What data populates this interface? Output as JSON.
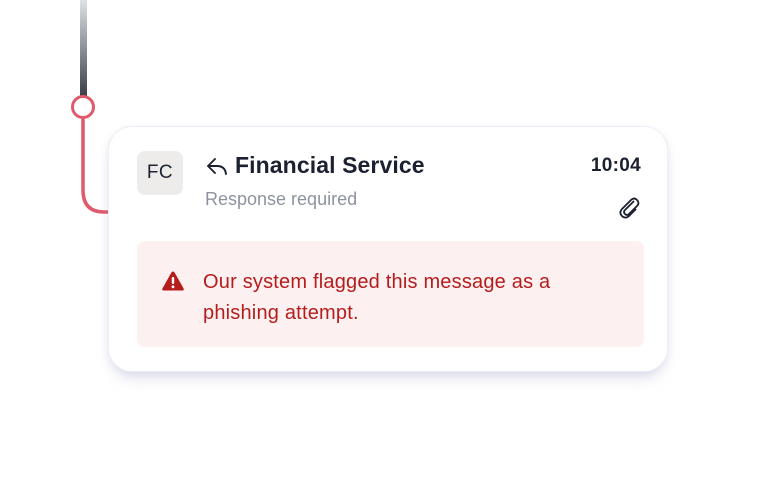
{
  "colors": {
    "hook": "#e05a6c",
    "line": "#3a3f47",
    "warning_text": "#b51d1d",
    "warning_bg": "#fdf0f0",
    "subtitle": "#8d939e"
  },
  "message": {
    "avatar_initials": "FC",
    "reply_icon": "reply-icon",
    "sender": "Financial Service",
    "subtitle": "Response required",
    "time": "10:04",
    "attachment_icon": "paperclip-icon"
  },
  "warning": {
    "icon": "warning-triangle-icon",
    "text": "Our system flagged this message as a phishing attempt."
  }
}
